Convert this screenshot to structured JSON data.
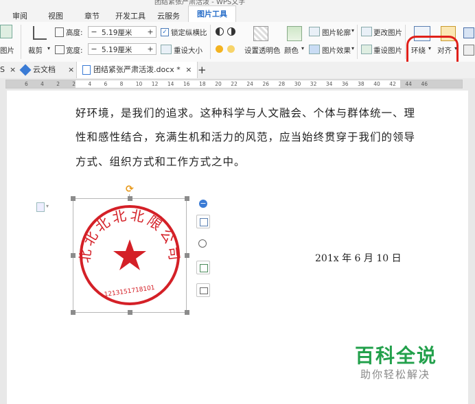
{
  "window": {
    "title_fragment": "团结紧张严肃活泼 - WPS文字"
  },
  "menu": {
    "tabs": [
      {
        "label": "审阅"
      },
      {
        "label": "视图"
      },
      {
        "label": "章节"
      },
      {
        "label": "开发工具"
      },
      {
        "label": "云服务"
      },
      {
        "label": "图片工具"
      }
    ]
  },
  "ribbon": {
    "insert_picture": "图片",
    "crop": "裁剪",
    "height_label": "高度:",
    "height_value": "5.19厘米",
    "width_label": "宽度:",
    "width_value": "5.19厘米",
    "lock_ratio": "锁定纵横比",
    "reset_size": "重设大小",
    "set_transparent": "设置透明色",
    "color": "颜色",
    "picture_outline": "图片轮廓",
    "picture_effect": "图片效果",
    "change_picture": "更改图片",
    "reset_picture": "重设图片",
    "wrap": "环绕",
    "align": "对齐",
    "minus": "−",
    "plus": "+"
  },
  "doc_tabs": {
    "tab1_close": "×",
    "cloud_docs": "云文档",
    "cloud_close": "×",
    "active_doc": "团结紧张严肃活泼.docx *",
    "active_close": "×",
    "new_tab": "+"
  },
  "ruler": {
    "ticks": [
      "6",
      "4",
      "2",
      "2",
      "4",
      "6",
      "8",
      "10",
      "12",
      "14",
      "16",
      "18",
      "20",
      "22",
      "24",
      "26",
      "28",
      "30",
      "32",
      "34",
      "36",
      "38",
      "40",
      "42",
      "44",
      "46"
    ]
  },
  "document": {
    "line1": "好环境，是我们的追求。这种科学与人文融会、个体与群体统一、理",
    "line2": "性和感性结合，充满生机和活力的风范，应当始终贯穿于我们的领导",
    "line3": "方式、组织方式和工作方式之中。",
    "date": "201x 年 6 月 10 日"
  },
  "stamp": {
    "text": "北北北北北限公司",
    "number": "1213151718101"
  },
  "watermark": {
    "title": "百科全说",
    "subtitle": "助你轻松解决"
  },
  "colors": {
    "accent": "#2a6fc9",
    "annotation": "#e0201a",
    "stamp": "#d42027",
    "watermark": "#22a04b"
  }
}
